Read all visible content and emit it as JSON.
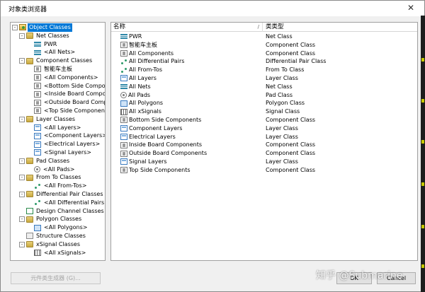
{
  "window": {
    "title": "对象类浏览器"
  },
  "colors": {
    "selection": "#0078d7"
  },
  "tree": [
    {
      "label": "Object Classes",
      "level": 0,
      "expander": "-",
      "icon": "root-icon",
      "selected": true
    },
    {
      "label": "Net Classes",
      "level": 1,
      "expander": "-",
      "icon": "net-class-icon"
    },
    {
      "label": "PWR",
      "level": 2,
      "icon": "net-icon"
    },
    {
      "label": "<All Nets>",
      "level": 2,
      "icon": "net-icon"
    },
    {
      "label": "Component Classes",
      "level": 1,
      "expander": "-",
      "icon": "component-class-icon"
    },
    {
      "label": "智能车主板",
      "level": 2,
      "icon": "component-icon"
    },
    {
      "label": "<All Components>",
      "level": 2,
      "icon": "component-icon"
    },
    {
      "label": "<Bottom Side Compor",
      "level": 2,
      "icon": "component-icon"
    },
    {
      "label": "<Inside Board Compo",
      "level": 2,
      "icon": "component-icon"
    },
    {
      "label": "<Outside Board Comp",
      "level": 2,
      "icon": "component-icon"
    },
    {
      "label": "<Top Side Componen",
      "level": 2,
      "icon": "component-icon"
    },
    {
      "label": "Layer Classes",
      "level": 1,
      "expander": "-",
      "icon": "layer-class-icon"
    },
    {
      "label": "<All Layers>",
      "level": 2,
      "icon": "layer-icon"
    },
    {
      "label": "<Component Layers>",
      "level": 2,
      "icon": "layer-icon"
    },
    {
      "label": "<Electrical Layers>",
      "level": 2,
      "icon": "layer-icon"
    },
    {
      "label": "<Signal Layers>",
      "level": 2,
      "icon": "layer-icon"
    },
    {
      "label": "Pad Classes",
      "level": 1,
      "expander": "-",
      "icon": "pad-class-icon"
    },
    {
      "label": "<All Pads>",
      "level": 2,
      "icon": "pad-icon"
    },
    {
      "label": "From To Classes",
      "level": 1,
      "expander": "-",
      "icon": "from-to-class-icon"
    },
    {
      "label": "<All From-Tos>",
      "level": 2,
      "icon": "from-to-icon"
    },
    {
      "label": "Differential Pair Classes",
      "level": 1,
      "expander": "-",
      "icon": "diff-pair-class-icon"
    },
    {
      "label": "<All Differential Pairs",
      "level": 2,
      "icon": "from-to-icon"
    },
    {
      "label": "Design Channel Classes",
      "level": 1,
      "icon": "design-channel-class-icon"
    },
    {
      "label": "Polygon Classes",
      "level": 1,
      "expander": "-",
      "icon": "polygon-class-icon"
    },
    {
      "label": "<All Polygons>",
      "level": 2,
      "icon": "polygon-icon"
    },
    {
      "label": "Structure Classes",
      "level": 1,
      "icon": "structure-class-icon"
    },
    {
      "label": "xSignal Classes",
      "level": 1,
      "expander": "-",
      "icon": "xsignal-class-icon"
    },
    {
      "label": "<All xSignals>",
      "level": 2,
      "icon": "xsignal-icon"
    }
  ],
  "list": {
    "columns": {
      "name": "名称",
      "type": "类类型",
      "sort_indicator": "/"
    },
    "rows": [
      {
        "name": "PWR",
        "type": "Net Class",
        "icon": "net-icon"
      },
      {
        "name": "智能车主板",
        "type": "Component Class",
        "icon": "component-icon"
      },
      {
        "name": "All Components",
        "type": "Component Class",
        "icon": "component-icon"
      },
      {
        "name": "All Differential Pairs",
        "type": "Differential Pair Class",
        "icon": "from-to-icon"
      },
      {
        "name": "All From-Tos",
        "type": "From To Class",
        "icon": "from-to-icon"
      },
      {
        "name": "All Layers",
        "type": "Layer Class",
        "icon": "layer-icon"
      },
      {
        "name": "All Nets",
        "type": "Net Class",
        "icon": "net-icon"
      },
      {
        "name": "All Pads",
        "type": "Pad Class",
        "icon": "pad-icon"
      },
      {
        "name": "All Polygons",
        "type": "Polygon Class",
        "icon": "polygon-icon"
      },
      {
        "name": "All xSignals",
        "type": "Signal Class",
        "icon": "xsignal-icon"
      },
      {
        "name": "Bottom Side Components",
        "type": "Component Class",
        "icon": "component-icon"
      },
      {
        "name": "Component Layers",
        "type": "Layer Class",
        "icon": "layer-icon"
      },
      {
        "name": "Electrical Layers",
        "type": "Layer Class",
        "icon": "layer-icon"
      },
      {
        "name": "Inside Board Components",
        "type": "Component Class",
        "icon": "component-icon"
      },
      {
        "name": "Outside Board Components",
        "type": "Component Class",
        "icon": "component-icon"
      },
      {
        "name": "Signal Layers",
        "type": "Layer Class",
        "icon": "layer-icon"
      },
      {
        "name": "Top Side Components",
        "type": "Component Class",
        "icon": "component-icon"
      }
    ]
  },
  "buttons": {
    "generate": "元件类生成器 (G)...",
    "ok": "OK",
    "cancel": "Cancel"
  },
  "watermark": "知乎 @Submarine"
}
